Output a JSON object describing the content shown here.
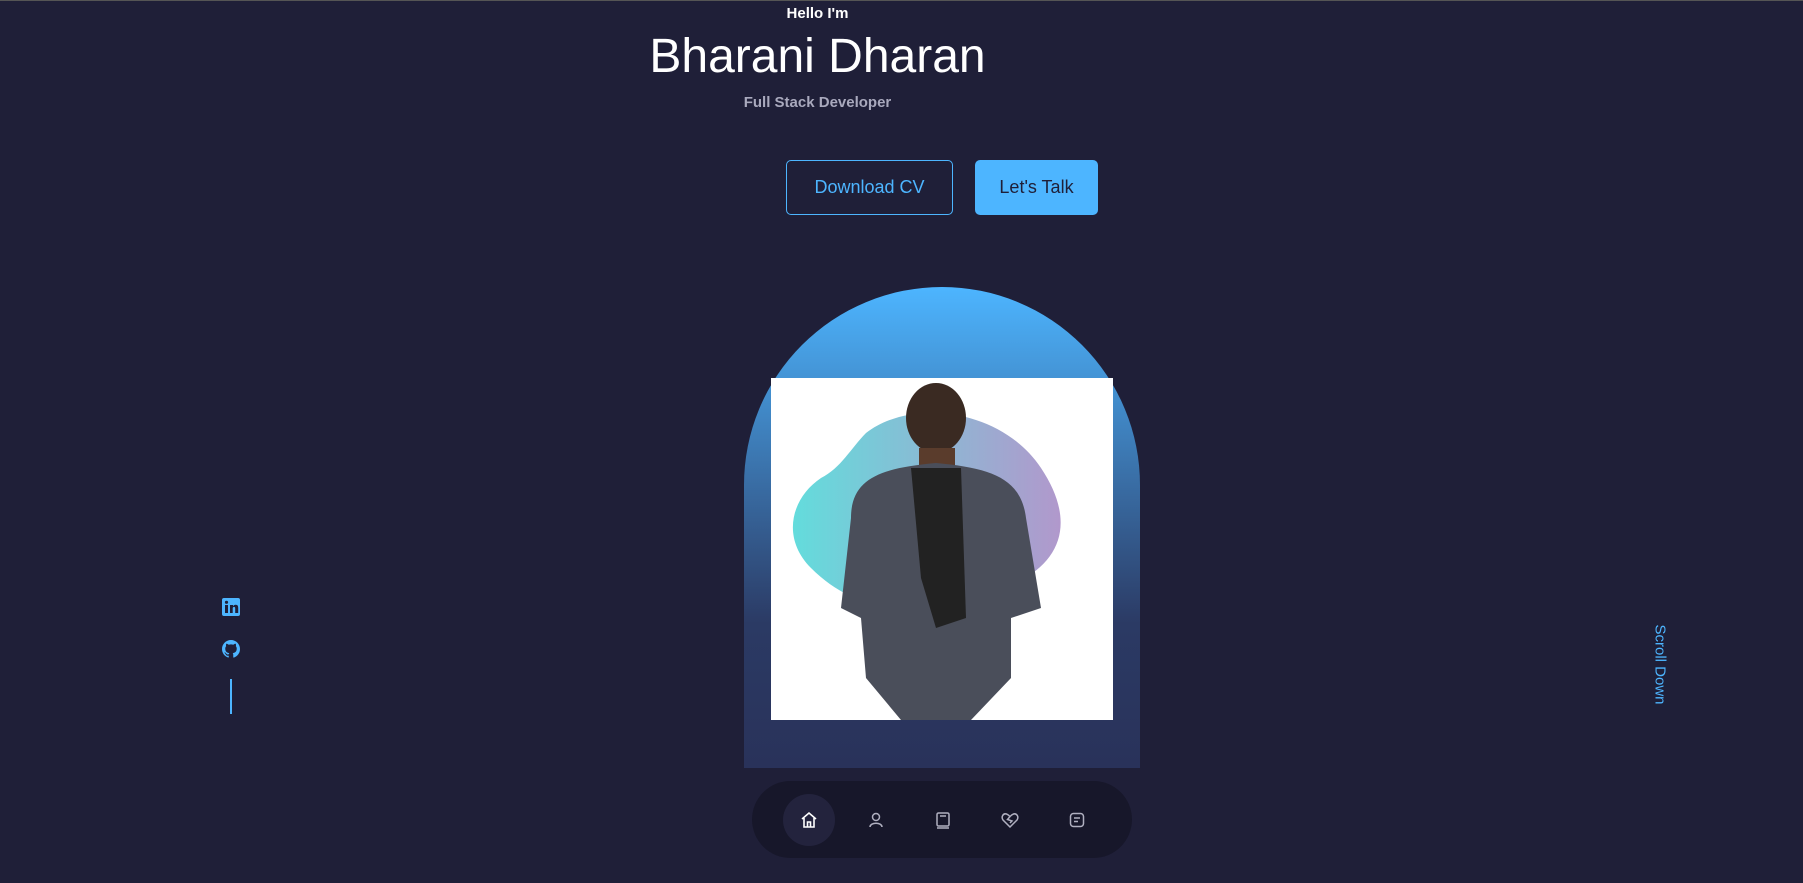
{
  "hero": {
    "greeting": "Hello I'm",
    "name": "Bharani Dharan",
    "role": "Full Stack Developer"
  },
  "buttons": {
    "download_cv": "Download CV",
    "lets_talk": "Let's Talk"
  },
  "social": [
    {
      "icon": "linkedin-icon"
    },
    {
      "icon": "github-icon"
    }
  ],
  "scroll_label": "Scroll Down",
  "nav": [
    {
      "icon": "home-icon",
      "active": true
    },
    {
      "icon": "user-icon"
    },
    {
      "icon": "book-icon"
    },
    {
      "icon": "services-heart-icon"
    },
    {
      "icon": "message-icon"
    }
  ],
  "colors": {
    "background": "#1f1f38",
    "accent": "#4db5ff",
    "nav_bg": "#17172a"
  }
}
